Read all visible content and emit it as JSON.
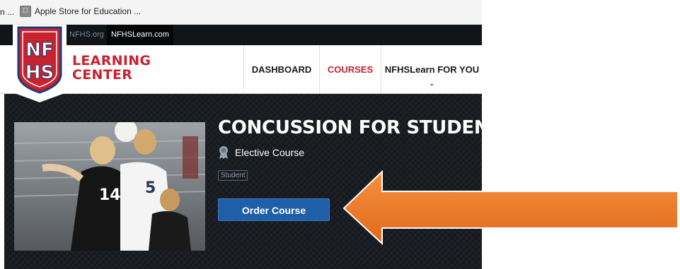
{
  "bookmarks": {
    "truncated": "n ...",
    "item_label": "Apple Store for Education ..."
  },
  "topbar": {
    "link1": "NFHS.org",
    "link2": "NFHSLearn.com"
  },
  "brand": {
    "line1": "LEARNING",
    "line2": "CENTER",
    "logo_text": "NFHS"
  },
  "nav": {
    "items": [
      {
        "label": "DASHBOARD"
      },
      {
        "label": "COURSES"
      },
      {
        "label": "NFHSLearn FOR YOU"
      }
    ]
  },
  "course": {
    "title": "CONCUSSION FOR STUDENTS",
    "type": "Elective Course",
    "tag": "Student",
    "order_label": "Order Course"
  },
  "colors": {
    "brand_red": "#c8222e",
    "button_blue": "#1e5fa8",
    "arrow_orange": "#f07b2a"
  }
}
